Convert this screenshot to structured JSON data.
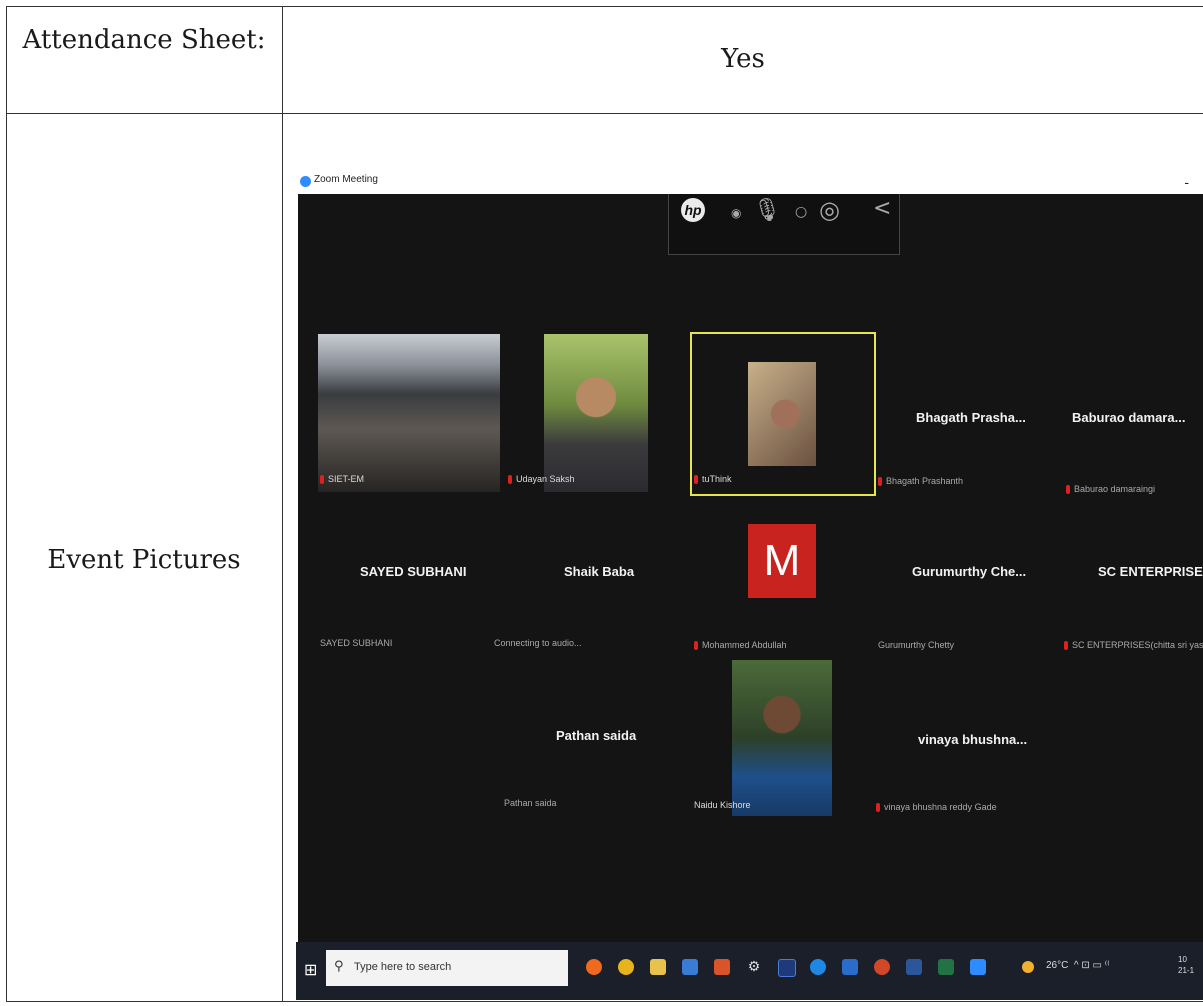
{
  "table": {
    "row1_label": "Attendance Sheet:",
    "row1_value": "Yes",
    "row2_label": "Event Pictures"
  },
  "screenshot": {
    "window_title": "Zoom Meeting",
    "minimize_glyph": "-",
    "hp_logo": "hp",
    "hp_collapse_glyph": "<",
    "participants": {
      "siet_em": "SIET-EM",
      "udayan": "Udayan Saksh",
      "tuthink": "tuThink",
      "bhagath_big": "Bhagath Prasha...",
      "bhagath_small": "Bhagath Prashanth",
      "baburao_big": "Baburao damara...",
      "baburao_small": "Baburao damaraingi",
      "sayed_big": "SAYED SUBHANI",
      "sayed_small": "SAYED SUBHANI",
      "shaik_big": "Shaik Baba",
      "shaik_small": "Connecting to audio...",
      "mohammed_initial": "M",
      "mohammed_small": "Mohammed Abdullah",
      "guru_big": "Gurumurthy Che...",
      "guru_small": "Gurumurthy Chetty",
      "sc_big": "SC ENTERPRISES...",
      "sc_small": "SC ENTERPRISES(chitta sri yas",
      "pathan_big": "Pathan saida",
      "pathan_small": "Pathan saida",
      "naidu_small": "Naidu Kishore",
      "vinaya_big": "vinaya bhushna...",
      "vinaya_small": "vinaya bhushna reddy Gade"
    },
    "taskbar": {
      "start_glyph": "⊞",
      "search_placeholder": "Type here to search",
      "search_glyph": "⚲",
      "temperature": "26°C",
      "tray_glyphs": "^ ⊡ ▭ ⁽⁽",
      "clock": "10",
      "date": "21-1"
    }
  },
  "colors": {
    "zoom_blue": "#2d8cff",
    "meeting_bg": "#141414",
    "active_speaker": "#e6e64a",
    "avatar_red": "#c8231e",
    "muted_mic": "#e02020"
  }
}
